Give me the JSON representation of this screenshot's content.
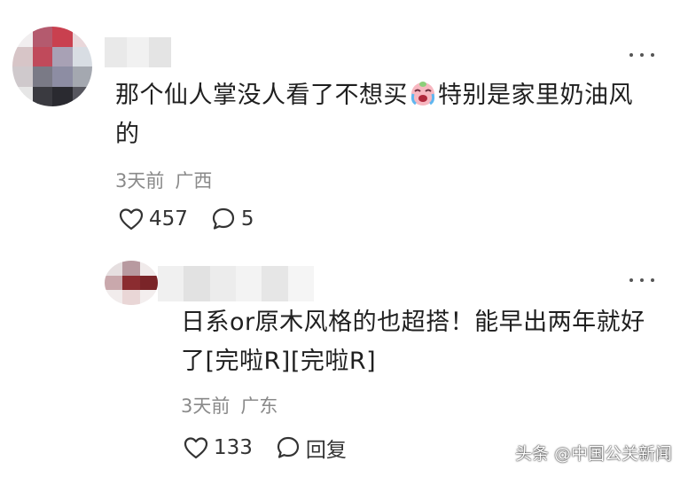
{
  "comments": [
    {
      "text_before_emoji": "那个仙人掌没人看了不想买",
      "emoji": "crying-face-emoji",
      "text_after_emoji_line1": "特别是家里奶油风",
      "text_line2": "的",
      "date": "3天前",
      "location": "广西",
      "like_count": "457",
      "reply_count": "5"
    },
    {
      "text_line1": "日系or原木风格的也超搭！能早出两年就好",
      "text_line2": "了[完啦R][完啦R]",
      "date": "3天前",
      "location": "广东",
      "like_count": "133",
      "reply_label": "回复"
    }
  ],
  "watermark": "头条 @中国公关新闻",
  "colors": {
    "text": "#1f1f1f",
    "meta": "#8a8a8a",
    "background": "#ffffff"
  }
}
